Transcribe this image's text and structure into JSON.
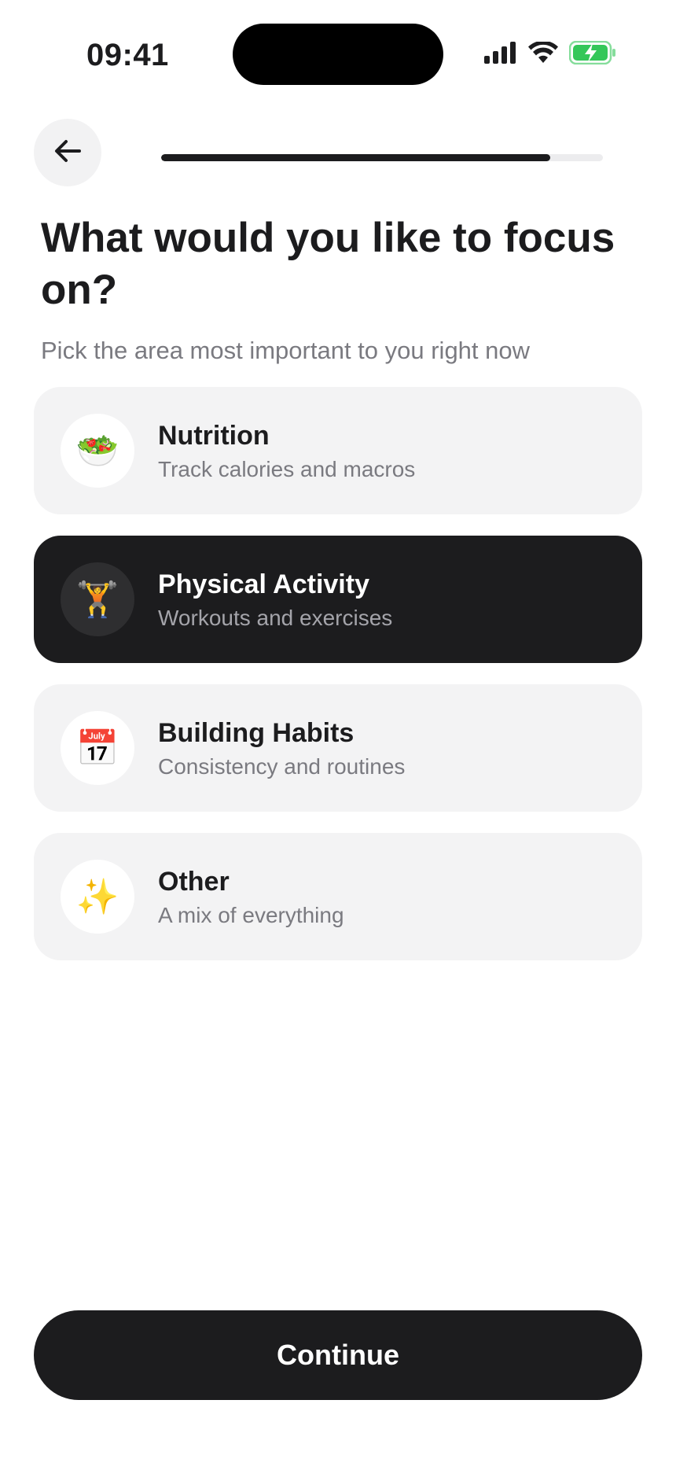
{
  "status_bar": {
    "time": "09:41"
  },
  "header": {
    "back_icon": "arrow-left-icon",
    "progress": 0.88
  },
  "title": "What would you like to focus on?",
  "subtitle": "Pick the area most important to you right now",
  "options": [
    {
      "id": "nutrition",
      "icon": "salad-icon",
      "emoji": "🥗",
      "title": "Nutrition",
      "description": "Track calories and macros",
      "selected": false
    },
    {
      "id": "physical-activity",
      "icon": "weightlifter-icon",
      "emoji": "🏋️",
      "title": "Physical Activity",
      "description": "Workouts and exercises",
      "selected": true
    },
    {
      "id": "building-habits",
      "icon": "calendar-icon",
      "emoji": "📅",
      "title": "Building Habits",
      "description": "Consistency and routines",
      "selected": false
    },
    {
      "id": "other",
      "icon": "sparkles-icon",
      "emoji": "✨",
      "title": "Other",
      "description": "A mix of everything",
      "selected": false
    }
  ],
  "continue_label": "Continue",
  "colors": {
    "primary": "#1c1c1e",
    "card": "#f3f3f4",
    "muted_text": "#7a7a80",
    "battery": "#34c759"
  }
}
